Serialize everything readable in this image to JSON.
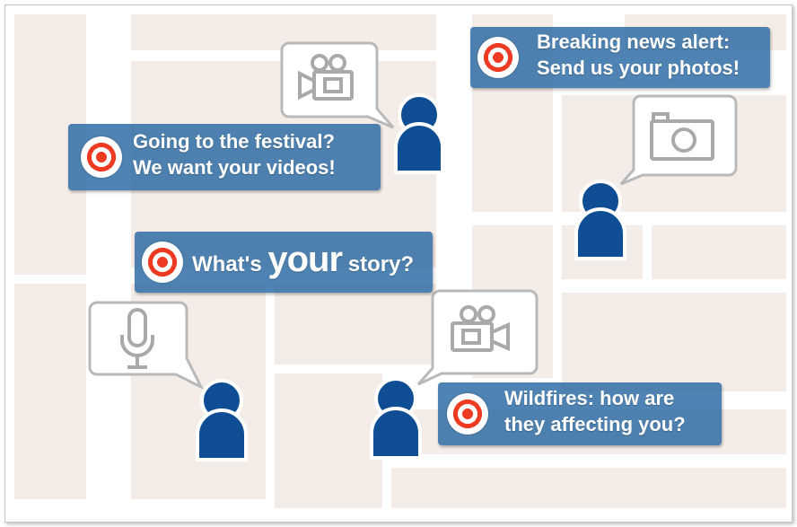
{
  "cards": {
    "breaking": {
      "line1": "Breaking news alert:",
      "line2": "Send us your photos!"
    },
    "festival": {
      "line1": "Going to the festival?",
      "line2": "We want your videos!"
    },
    "story": {
      "before": "What's ",
      "emph": "your",
      "after": " story?"
    },
    "wildfires": {
      "line1": "Wildfires: how are",
      "line2": "they affecting you?"
    }
  },
  "icons": {
    "target": "target-icon",
    "video": "video-camera-icon",
    "photo": "photo-camera-icon",
    "audio": "microphone-icon",
    "person": "person-icon"
  },
  "colors": {
    "card": "#2364a0",
    "target_red": "#ee3a21",
    "person": "#0f4d94",
    "block": "#f4ede7",
    "icon_gray": "#a9a9a9"
  }
}
